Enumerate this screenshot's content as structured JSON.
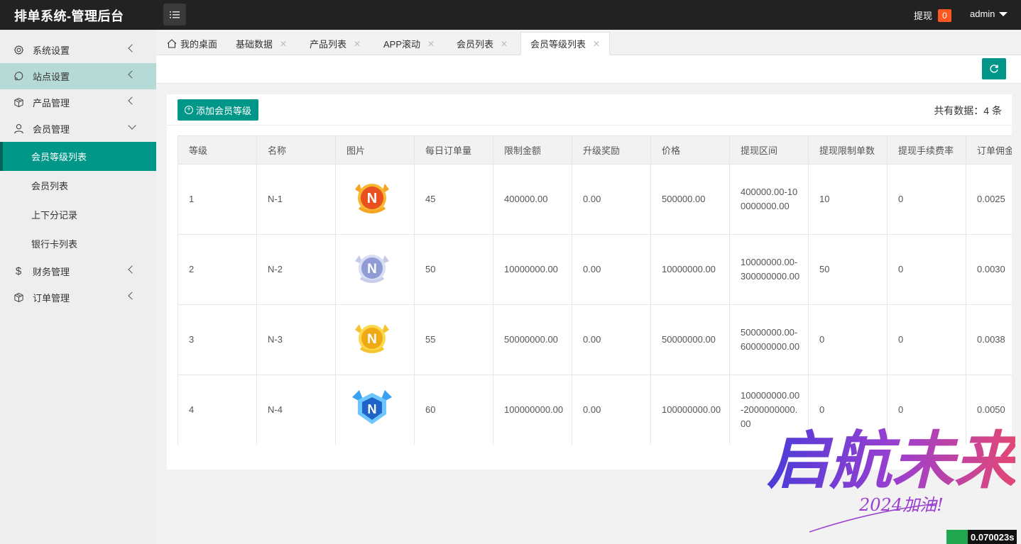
{
  "header": {
    "title": "排单系统-管理后台",
    "withdraw_label": "提现",
    "withdraw_count": "0",
    "user_name": "admin"
  },
  "sidebar": {
    "items": [
      {
        "label": "系统设置",
        "icon": "gear-icon"
      },
      {
        "label": "站点设置",
        "icon": "globe-icon"
      },
      {
        "label": "产品管理",
        "icon": "box-icon"
      },
      {
        "label": "会员管理",
        "icon": "user-icon"
      },
      {
        "label": "财务管理",
        "icon": "dollar-icon"
      },
      {
        "label": "订单管理",
        "icon": "box-icon"
      }
    ],
    "sub_items": [
      {
        "label": "会员等级列表"
      },
      {
        "label": "会员列表"
      },
      {
        "label": "上下分记录"
      },
      {
        "label": "银行卡列表"
      }
    ]
  },
  "tabs": [
    {
      "label": "我的桌面"
    },
    {
      "label": "基础数据"
    },
    {
      "label": "产品列表"
    },
    {
      "label": "APP滚动"
    },
    {
      "label": "会员列表"
    },
    {
      "label": "会员等级列表"
    }
  ],
  "content": {
    "add_button": "添加会员等级",
    "total_text": "共有数据：4 条"
  },
  "table": {
    "headers": [
      "等级",
      "名称",
      "图片",
      "每日订单量",
      "限制金额",
      "升级奖励",
      "价格",
      "提现区间",
      "提现限制单数",
      "提现手续费率",
      "订单佣金"
    ],
    "rows": [
      {
        "level": "1",
        "name": "N-1",
        "badge": "orange",
        "daily": "45",
        "limit": "400000.00",
        "bonus": "0.00",
        "price": "500000.00",
        "range": "400000.00-100000000.00",
        "limit_count": "10",
        "fee": "0",
        "commission": "0.0025"
      },
      {
        "level": "2",
        "name": "N-2",
        "badge": "silver",
        "daily": "50",
        "limit": "10000000.00",
        "bonus": "0.00",
        "price": "10000000.00",
        "range": "10000000.00-300000000.00",
        "limit_count": "50",
        "fee": "0",
        "commission": "0.0030"
      },
      {
        "level": "3",
        "name": "N-3",
        "badge": "gold",
        "daily": "55",
        "limit": "50000000.00",
        "bonus": "0.00",
        "price": "50000000.00",
        "range": "50000000.00-600000000.00",
        "limit_count": "0",
        "fee": "0",
        "commission": "0.0038"
      },
      {
        "level": "4",
        "name": "N-4",
        "badge": "blue",
        "daily": "60",
        "limit": "100000000.00",
        "bonus": "0.00",
        "price": "100000000.00",
        "range": "100000000.00-2000000000.00",
        "limit_count": "0",
        "fee": "0",
        "commission": "0.0050"
      }
    ]
  },
  "watermark": {
    "main": "启航未来",
    "sub": "2024加油!"
  },
  "timer": "0.070023s",
  "colors": {
    "primary": "#009688",
    "header_bg": "#222222",
    "badge": "#ff5722",
    "sidebar_active_parent": "#b6dbd7"
  }
}
